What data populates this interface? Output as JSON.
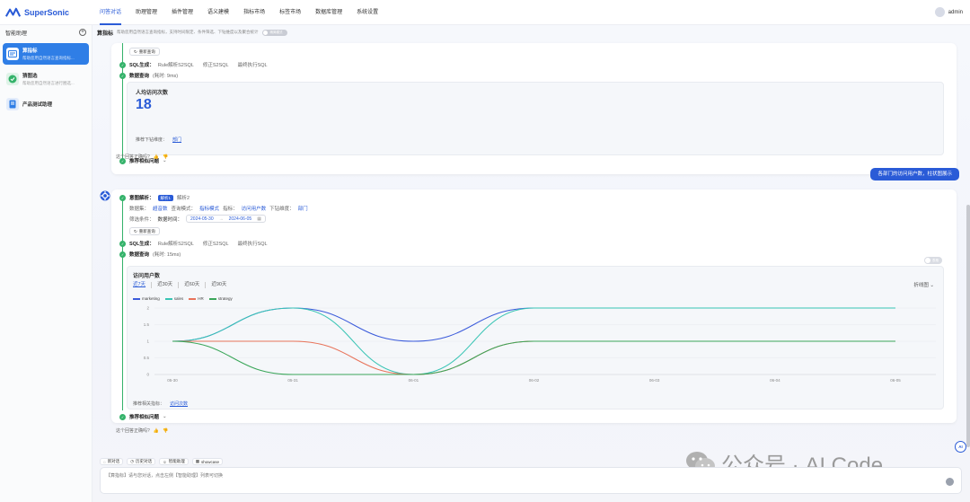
{
  "brand": {
    "name": "SuperSonic",
    "color": "#2a5bd7"
  },
  "nav": {
    "items": [
      "问答对话",
      "助理管理",
      "插件管理",
      "语义建模",
      "指标市场",
      "标签市场",
      "数据库管理",
      "系统设置"
    ],
    "active_index": 0
  },
  "user": {
    "name": "admin"
  },
  "sidebar": {
    "title": "智能助理",
    "items": [
      {
        "title": "算指标",
        "subtitle": "帮助您用自然语言查询指标...",
        "active": true
      },
      {
        "title": "猜图选",
        "subtitle": "帮助您用自然语言进行圈选...",
        "active": false
      },
      {
        "title": "产品测试助理",
        "subtitle": "",
        "active": false
      }
    ]
  },
  "header": {
    "title": "算指标",
    "description": "帮助您用自然语言查询指标，支持时间限定、条件筛选、下钻维度以及聚合统计",
    "toggle_label": "精简模式"
  },
  "card1": {
    "requery_label": "重新查询",
    "sql_step_label": "SQL生成：",
    "sql_step_items": [
      "Rule解析S2SQL",
      "修正S2SQL",
      "最终执行SQL"
    ],
    "data_step_label": "数据查询",
    "data_step_time": "(耗时: 9ms)",
    "metric_title": "人均访问次数",
    "metric_value": "18",
    "drill_label": "推荐下钻维度：",
    "drill_value": "部门",
    "similar_label": "推荐相似问题",
    "feedback_label": "这个回答正确吗?"
  },
  "user_message": "各部门的访问用户数，柱状图展示",
  "card2": {
    "intent_label": "意图解析：",
    "intent_tags": [
      "解析1",
      "解析2"
    ],
    "dataset_label": "数据集：",
    "dataset_value": "超音数",
    "mode_label": "查询模式：",
    "mode_value": "指标模式",
    "metric_label": "指标：",
    "metric_value": "访问用户数",
    "dim_label": "下钻维度：",
    "dim_value": "部门",
    "filter_label": "筛选条件：",
    "filter_field": "数据时间：",
    "date_start": "2024-05-30",
    "date_end": "2024-06-05",
    "requery_label": "重新查询",
    "sql_step_label": "SQL生成：",
    "sql_step_items": [
      "Rule解析S2SQL",
      "修正S2SQL",
      "最终执行SQL"
    ],
    "data_step_label": "数据查询",
    "data_step_time": "(耗时: 15ms)",
    "switch_label": "表格",
    "chart_title": "访问用户数",
    "range_tabs": [
      "近7天",
      "近30天",
      "近60天",
      "近90天"
    ],
    "chart_type_label": "折线图",
    "related_label": "推荐相关指标：",
    "related_value": "访问次数",
    "similar_label": "推荐相似问题",
    "feedback_label": "这个回答正确吗?"
  },
  "chart_data": {
    "type": "line",
    "x": [
      "05-30",
      "05-31",
      "06-01",
      "06-02",
      "06-03",
      "06-04",
      "06-05"
    ],
    "ylim": [
      0,
      2
    ],
    "yticks": [
      "0",
      "0.5",
      "1",
      "1.5",
      "2"
    ],
    "legend_position": "top-left",
    "series": [
      {
        "name": "marketing",
        "color": "#3b5bdb",
        "values": [
          1,
          2,
          1,
          2,
          2,
          2,
          2
        ]
      },
      {
        "name": "sales",
        "color": "#38c4b4",
        "values": [
          1,
          2,
          0,
          2,
          2,
          2,
          2
        ]
      },
      {
        "name": "HR",
        "color": "#e8735a",
        "values": [
          1,
          1,
          0,
          1,
          1,
          1,
          1
        ]
      },
      {
        "name": "strategy",
        "color": "#3aa659",
        "values": [
          1,
          0,
          0,
          1,
          1,
          1,
          1
        ]
      }
    ]
  },
  "input": {
    "tools": [
      "新对话",
      "历史对话",
      "智能助理",
      "showcase"
    ],
    "placeholder": "【算指标】请与您对话，点击左侧【智能助理】列表可切换"
  },
  "ai_badge": "AI",
  "watermark": "公众号 · AI Code"
}
